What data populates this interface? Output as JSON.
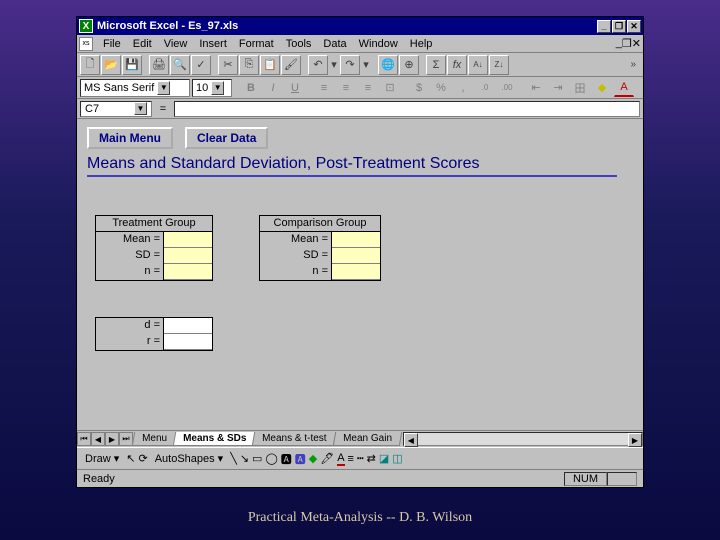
{
  "window": {
    "title": "Microsoft Excel - Es_97.xls",
    "controls": {
      "min": "_",
      "max": "❐",
      "close": "✕"
    }
  },
  "menu": [
    "File",
    "Edit",
    "View",
    "Insert",
    "Format",
    "Tools",
    "Data",
    "Window",
    "Help"
  ],
  "toolbar1": {
    "new": "🗋",
    "open": "📂",
    "save": "💾",
    "print": "🖨",
    "preview": "🔍",
    "spell": "✓",
    "cut": "✂",
    "copy": "⎘",
    "paste": "📋",
    "fmtpaint": "🖌",
    "undo": "↶",
    "redo": "↷",
    "link": "🌐",
    "web": "⊕",
    "sum": "Σ",
    "fx": "fx",
    "sortA": "A↓",
    "sortZ": "Z↓",
    "more": "»"
  },
  "fmtbar": {
    "font": "MS Sans Serif",
    "size": "10",
    "bold": "B",
    "italic": "I",
    "under": "U",
    "alignL": "≡",
    "alignC": "≡",
    "alignR": "≡",
    "merge": "⊡",
    "curr": "$",
    "pct": "%",
    "comma": ",",
    "decInc": ".0",
    "decDec": ".00",
    "indent1": "⇤",
    "indent2": "⇥",
    "border": "田",
    "fill": "◆",
    "font_color": "A"
  },
  "formula": {
    "cell": "C7",
    "eq": "="
  },
  "sheet": {
    "btn_menu": "Main Menu",
    "btn_clear": "Clear Data",
    "title": "Means and Standard Deviation, Post-Treatment Scores",
    "group1": {
      "header": "Treatment Group",
      "mean": "Mean =",
      "sd": "SD =",
      "n": "n ="
    },
    "group2": {
      "header": "Comparison Group",
      "mean": "Mean =",
      "sd": "SD =",
      "n": "n ="
    },
    "result": {
      "d": "d =",
      "r": "r ="
    }
  },
  "tabs": {
    "nav": [
      "⏮",
      "◀",
      "▶",
      "⏭"
    ],
    "items": [
      "Menu",
      "Means & SDs",
      "Means & t-test",
      "Mean Gain"
    ],
    "active": 1
  },
  "drawbar": {
    "draw": "Draw ▾",
    "arrow": "↖",
    "rotate": "⟳",
    "autoshapes": "AutoShapes ▾",
    "line": "╲",
    "arrow2": "↘",
    "rect": "▭",
    "oval": "◯",
    "text": "🅰",
    "wordart": "🅰",
    "fill": "◆",
    "linecolor": "🖊",
    "fontcolor": "A",
    "lineweight": "≡",
    "dash": "┅",
    "arrowstyle": "⇄",
    "shadow": "◪",
    "3d": "◫"
  },
  "status": {
    "ready": "Ready",
    "num": "NUM"
  },
  "caption": "Practical Meta-Analysis -- D. B. Wilson"
}
